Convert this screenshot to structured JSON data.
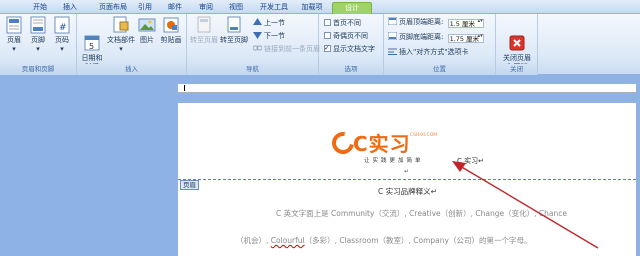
{
  "tabs": [
    {
      "label": "开始"
    },
    {
      "label": "插入"
    },
    {
      "label": "页面布局"
    },
    {
      "label": "引用"
    },
    {
      "label": "邮件"
    },
    {
      "label": "审阅"
    },
    {
      "label": "视图"
    },
    {
      "label": "开发工具"
    },
    {
      "label": "加载项"
    },
    {
      "label": "设计"
    }
  ],
  "groups": {
    "header_footer": {
      "label": "页眉和页脚",
      "buttons": [
        {
          "label": "页眉"
        },
        {
          "label": "页脚"
        },
        {
          "label": "页码"
        }
      ]
    },
    "insert": {
      "label": "插入",
      "buttons": [
        {
          "label": "日期和\n时间"
        },
        {
          "label": "文档部件"
        },
        {
          "label": "图片"
        },
        {
          "label": "剪贴画"
        }
      ]
    },
    "navigation": {
      "label": "导航",
      "goto_header": "转至页眉",
      "goto_footer": "转至页脚",
      "prev_section": "上一节",
      "next_section": "下一节",
      "link_previous": "链接到前一条页眉"
    },
    "options": {
      "label": "选项",
      "first_page": "首页不同",
      "odd_even": "奇偶页不同",
      "show_text": "显示文档文字"
    },
    "position": {
      "label": "位置",
      "header_from_top": "页眉顶端距离:",
      "header_value": "1.5 厘米",
      "footer_from_bottom": "页脚底端距离:",
      "footer_value": "1.75 厘米",
      "insert_align_tab": "插入\"对齐方式\"选项卡"
    },
    "close": {
      "label": "关闭",
      "button": "关闭页眉\n和页脚"
    }
  },
  "document": {
    "header_tag": "页眉",
    "logo_text": "C实习",
    "logo_url": "CSHIXI.COM",
    "logo_slogan": "让实践更加简单",
    "logo_side_text": "C 实习",
    "return_mark": "↵",
    "heading": "C 实习品牌释义↵",
    "para1": "C 英文字面上是 Community（交流）, Creative（创新）, Change（变化）, Chance",
    "para2_a": "（机会）,",
    "para2_b": "Colourful",
    "para2_c": "（多彩）, Classroom（教室）, Company（公司）的第一个字母。"
  },
  "colors": {
    "accent_orange": "#f06a0f",
    "design_tab": "#9fd36a",
    "close_red": "#d9362b",
    "arrow": "#c0272d"
  }
}
